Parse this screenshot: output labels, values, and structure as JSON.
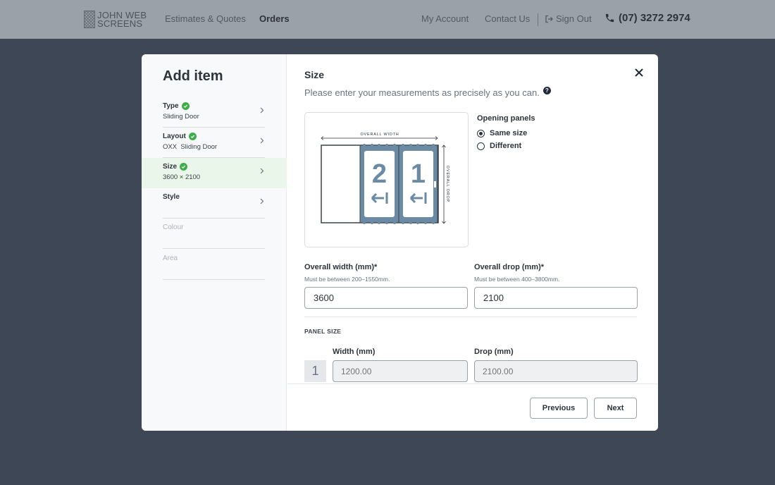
{
  "brand": {
    "line1": "JOHN WEB",
    "line2": "SCREENS"
  },
  "nav": {
    "estimates": "Estimates & Quotes",
    "orders": "Orders",
    "account": "My Account",
    "contact": "Contact Us",
    "signout": "Sign Out",
    "phone": "(07) 3272 2974"
  },
  "modal": {
    "heading": "Add item",
    "steps": [
      {
        "title": "Type",
        "value": "Sliding Door",
        "complete": true
      },
      {
        "title": "Layout",
        "value": "OXX  Sliding Door",
        "complete": true
      },
      {
        "title": "Size",
        "value": "3600 × 2100",
        "complete": true,
        "current": true
      },
      {
        "title": "Style",
        "value": "",
        "complete": false
      },
      {
        "title": "Colour",
        "value": "",
        "complete": false
      },
      {
        "title": "Area",
        "value": "",
        "complete": false
      }
    ],
    "section_title": "Size",
    "description": "Please enter your measurements as precisely as you can.",
    "diagram": {
      "width_label": "OVERALL WIDTH",
      "drop_label": "OVERALL DROP",
      "panel_labels": [
        "2",
        "1"
      ]
    },
    "opening_panels": {
      "title": "Opening panels",
      "options": [
        "Same size",
        "Different"
      ],
      "selected": "Same size"
    },
    "overall_width": {
      "label": "Overall width (mm)*",
      "hint": "Must be between 200–1550mm.",
      "value": "3600"
    },
    "overall_drop": {
      "label": "Overall drop (mm)*",
      "hint": "Must be between 400–3800mm.",
      "value": "2100"
    },
    "panel_size": {
      "caption": "PANEL SIZE",
      "width_label": "Width (mm)",
      "drop_label": "Drop (mm)",
      "rows": [
        {
          "number": "1",
          "width_placeholder": "1200.00",
          "drop_placeholder": "2100.00"
        }
      ]
    },
    "buttons": {
      "previous": "Previous",
      "next": "Next"
    }
  },
  "colors": {
    "nav_bg": "#9aa1a9",
    "page_bg": "#3d4756",
    "check_green": "#3fae49",
    "current_step_bg": "#e9f6e9",
    "panel_blue": "#6b8aa3"
  }
}
